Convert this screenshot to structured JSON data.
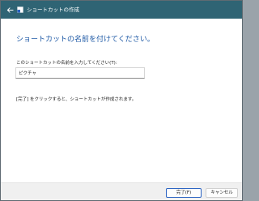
{
  "window": {
    "title": "ショートカットの作成",
    "back_icon": "arrow-left-icon",
    "app_icon": "shortcut-app-icon"
  },
  "main": {
    "heading": "ショートカットの名前を付けてください。",
    "field_label": "このショートカットの名前を入力してください(T):",
    "name_value": "ピクチャ",
    "hint": "[完了] をクリックすると、ショートカットが作成されます。"
  },
  "footer": {
    "finish_label": "完了(F)",
    "cancel_label": "キャンセル"
  },
  "colors": {
    "titlebar": "#2f6474",
    "heading": "#1f5aa6",
    "default_button_border": "#2b63c2"
  }
}
